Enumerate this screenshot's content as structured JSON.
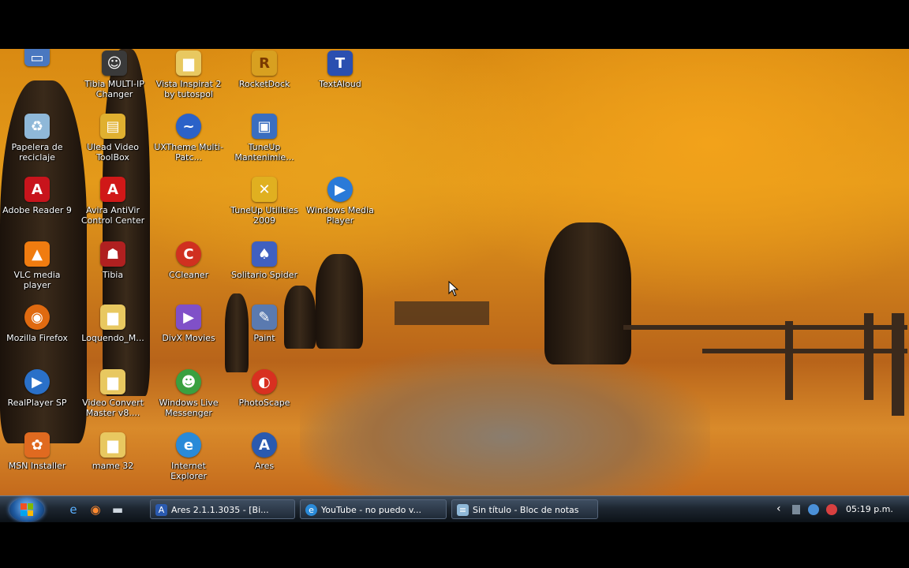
{
  "desktop": {
    "icons": [
      {
        "label": "Tibia MULTI-IP Changer",
        "icon": "tibia-ip-icon",
        "color": "#3a3a3a"
      },
      {
        "label": "Vista Inspirat 2 by tutospol",
        "icon": "folder-icon",
        "color": "#e8c860"
      },
      {
        "label": "RocketDock",
        "icon": "rocketdock-icon",
        "color": "#d8a020"
      },
      {
        "label": "TextAloud",
        "icon": "textaloud-icon",
        "color": "#2a4fb0"
      },
      {
        "label": "Papelera de reciclaje",
        "icon": "recycle-bin-icon",
        "color": "#8fb8d8"
      },
      {
        "label": "Ulead Video ToolBox",
        "icon": "ulead-icon",
        "color": "#e0b030"
      },
      {
        "label": "UXTheme Multi-Patc...",
        "icon": "uxtheme-icon",
        "color": "#2b62c8"
      },
      {
        "label": "TuneUp Mantenimie...",
        "icon": "tuneup-maintenance-icon",
        "color": "#3a6ec0"
      },
      {
        "label": "Adobe Reader 9",
        "icon": "adobe-reader-icon",
        "color": "#c8141c"
      },
      {
        "label": "Avira AntiVir Control Center",
        "icon": "avira-icon",
        "color": "#d01818"
      },
      {
        "label": "TuneUp Utilities 2009",
        "icon": "tuneup-utilities-icon",
        "color": "#e0b020"
      },
      {
        "label": "Windows Media Player",
        "icon": "media-player-icon",
        "color": "#2a7ad8"
      },
      {
        "label": "VLC media player",
        "icon": "vlc-icon",
        "color": "#f07c10"
      },
      {
        "label": "Tibia",
        "icon": "tibia-icon",
        "color": "#b02020"
      },
      {
        "label": "CCleaner",
        "icon": "ccleaner-icon",
        "color": "#d03020"
      },
      {
        "label": "Solitario Spider",
        "icon": "spider-solitaire-icon",
        "color": "#4060c0"
      },
      {
        "label": "Mozilla Firefox",
        "icon": "firefox-icon",
        "color": "#e06a10"
      },
      {
        "label": "Loquendo_M...",
        "icon": "folder-icon",
        "color": "#e8c860"
      },
      {
        "label": "DivX Movies",
        "icon": "divx-icon",
        "color": "#8050c8"
      },
      {
        "label": "Paint",
        "icon": "paint-icon",
        "color": "#5a7ab0"
      },
      {
        "label": "RealPlayer SP",
        "icon": "realplayer-icon",
        "color": "#2a70c8"
      },
      {
        "label": "Video Convert Master v8....",
        "icon": "folder-icon",
        "color": "#e8c860"
      },
      {
        "label": "Windows Live Messenger",
        "icon": "messenger-icon",
        "color": "#3aa040"
      },
      {
        "label": "PhotoScape",
        "icon": "photoscape-icon",
        "color": "#d83020"
      },
      {
        "label": "MSN Installer",
        "icon": "msn-icon",
        "color": "#e06a20"
      },
      {
        "label": "mame 32",
        "icon": "folder-icon",
        "color": "#e8c860"
      },
      {
        "label": "Internet Explorer",
        "icon": "ie-icon",
        "color": "#2a8ad8"
      },
      {
        "label": "Ares",
        "icon": "ares-icon",
        "color": "#2a5ab0"
      }
    ]
  },
  "taskbar": {
    "quick_launch": [
      {
        "icon": "ie-icon",
        "glyph": "e"
      },
      {
        "icon": "firefox-icon",
        "glyph": "◉"
      },
      {
        "icon": "show-desktop-icon",
        "glyph": "▬"
      }
    ],
    "buttons": [
      {
        "label": "Ares 2.1.1.3035 - [Bi...",
        "icon": "ares-icon"
      },
      {
        "label": "YouTube - no puedo v...",
        "icon": "ie-icon"
      },
      {
        "label": "Sin título - Bloc de notas",
        "icon": "notepad-icon"
      }
    ],
    "tray": {
      "chevron": "‹",
      "clock": "05:19 p.m."
    }
  }
}
